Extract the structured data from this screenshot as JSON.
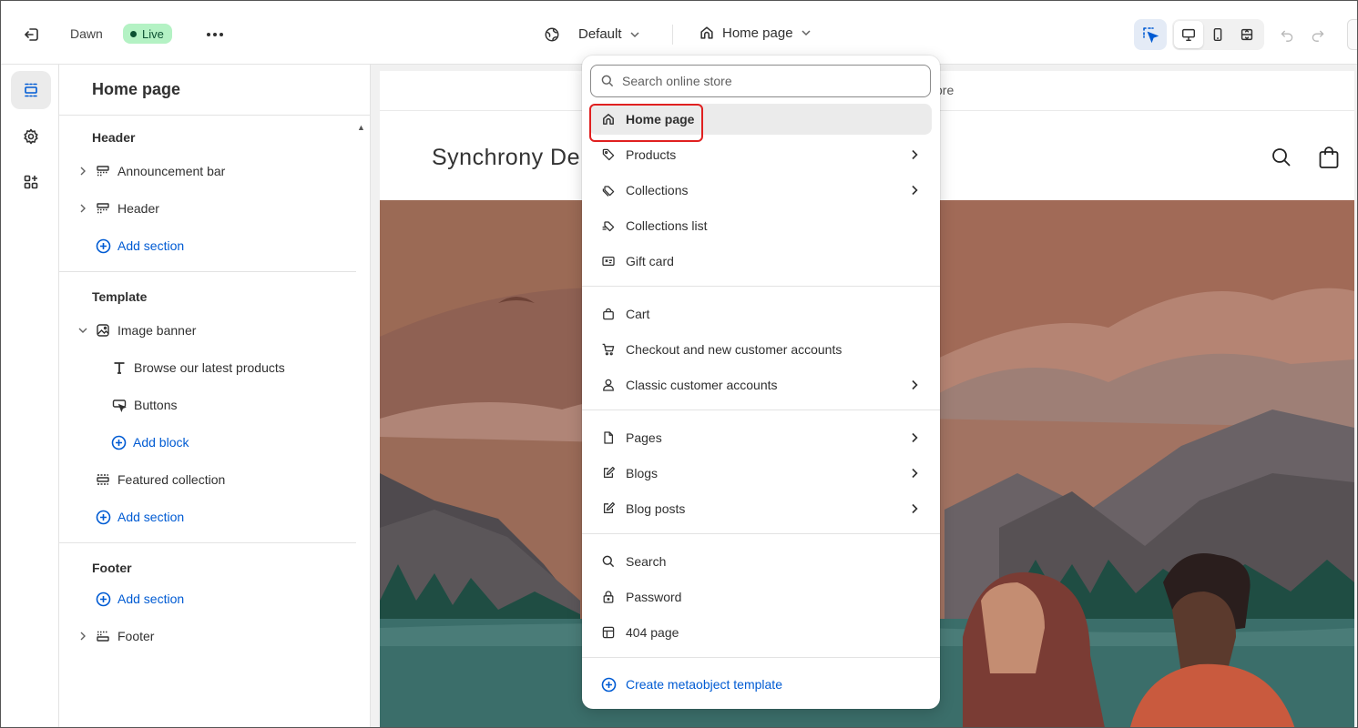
{
  "topbar": {
    "theme_name": "Dawn",
    "live_badge": "Live",
    "theme_select": "Default",
    "page_select": "Home page"
  },
  "sidebar": {
    "title": "Home page",
    "groups": [
      {
        "title": "Header",
        "rows": [
          {
            "label": "Announcement bar"
          },
          {
            "label": "Header"
          },
          {
            "label": "Add section"
          }
        ]
      },
      {
        "title": "Template",
        "rows": [
          {
            "label": "Image banner"
          },
          {
            "label": "Browse our latest products"
          },
          {
            "label": "Buttons"
          },
          {
            "label": "Add block"
          },
          {
            "label": "Featured collection"
          },
          {
            "label": "Add section"
          }
        ]
      },
      {
        "title": "Footer",
        "rows": [
          {
            "label": "Add section"
          },
          {
            "label": "Footer"
          }
        ]
      }
    ]
  },
  "preview": {
    "announcement_partial": "ore",
    "store_name": "Synchrony De"
  },
  "dropdown": {
    "search_placeholder": "Search online store",
    "items": [
      {
        "label": "Home page",
        "icon": "home-icon",
        "selected": true
      },
      {
        "label": "Products",
        "icon": "tag-icon",
        "submenu": true
      },
      {
        "label": "Collections",
        "icon": "collection-icon",
        "submenu": true
      },
      {
        "label": "Collections list",
        "icon": "collections-list-icon"
      },
      {
        "label": "Gift card",
        "icon": "gift-card-icon"
      },
      {
        "label": "Cart",
        "icon": "bag-icon"
      },
      {
        "label": "Checkout and new customer accounts",
        "icon": "cart-icon"
      },
      {
        "label": "Classic customer accounts",
        "icon": "person-icon",
        "submenu": true
      },
      {
        "label": "Pages",
        "icon": "page-icon",
        "submenu": true
      },
      {
        "label": "Blogs",
        "icon": "blog-icon",
        "submenu": true
      },
      {
        "label": "Blog posts",
        "icon": "blog-post-icon",
        "submenu": true
      },
      {
        "label": "Search",
        "icon": "search-icon"
      },
      {
        "label": "Password",
        "icon": "lock-icon"
      },
      {
        "label": "404 page",
        "icon": "layout-icon"
      },
      {
        "label": "Create metaobject template",
        "icon": "plus-circle-icon"
      }
    ]
  },
  "colors": {
    "accent_link": "#005bd3",
    "live_badge_bg": "#b4f2c4",
    "highlight_outline": "#e02020"
  }
}
